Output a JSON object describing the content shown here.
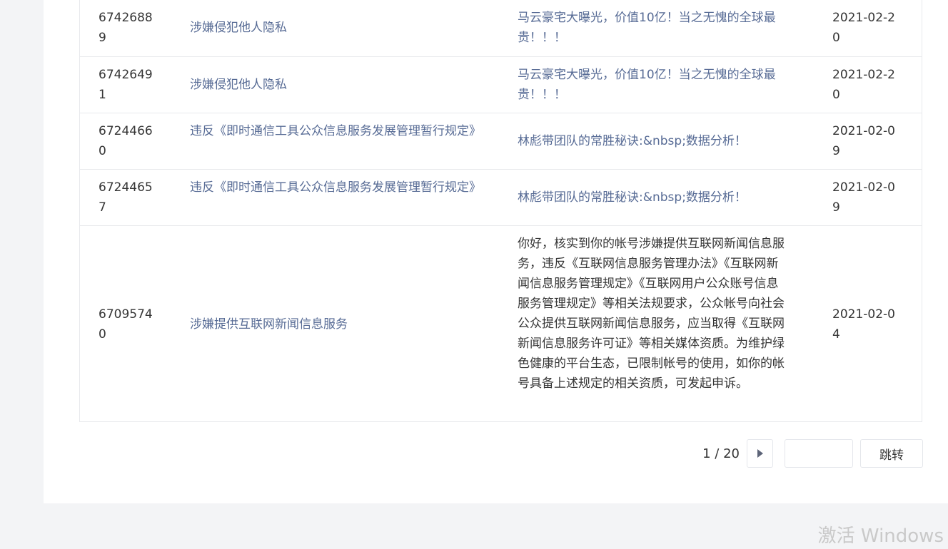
{
  "rows": [
    {
      "id": "67426889",
      "reason": "涉嫌侵犯他人隐私",
      "title": "马云豪宅大曝光，价值10亿！当之无愧的全球最贵！！！",
      "date": "2021-02-20"
    },
    {
      "id": "67426491",
      "reason": "涉嫌侵犯他人隐私",
      "title": "马云豪宅大曝光，价值10亿！当之无愧的全球最贵！！！",
      "date": "2021-02-20"
    },
    {
      "id": "67244660",
      "reason": "违反《即时通信工具公众信息服务发展管理暂行规定》",
      "title": "林彪带团队的常胜秘诀:&nbsp;数据分析！",
      "date": "2021-02-09"
    },
    {
      "id": "67244657",
      "reason": "违反《即时通信工具公众信息服务发展管理暂行规定》",
      "title": "林彪带团队的常胜秘诀:&nbsp;数据分析！",
      "date": "2021-02-09"
    },
    {
      "id": "67095740",
      "reason": "涉嫌提供互联网新闻信息服务",
      "title": "你好，核实到你的帐号涉嫌提供互联网新闻信息服务，违反《互联网信息服务管理办法》《互联网新闻信息服务管理规定》《互联网用户公众账号信息服务管理规定》等相关法规要求，公众帐号向社会公众提供互联网新闻信息服务，应当取得《互联网新闻信息服务许可证》等相关媒体资质。为维护绿色健康的平台生态，已限制帐号的使用，如你的帐号具备上述规定的相关资质，可发起申诉。",
      "date": "2021-02-04"
    }
  ],
  "pagination": {
    "page_info": "1 / 20",
    "next_icon": "triangle-right-icon",
    "input_value": "",
    "jump_label": "跳转"
  },
  "watermark": "激活 Windows",
  "colors": {
    "link": "#576b95",
    "text": "#353535",
    "border": "#e8e9ec",
    "page_bg": "#f3f4f6"
  }
}
